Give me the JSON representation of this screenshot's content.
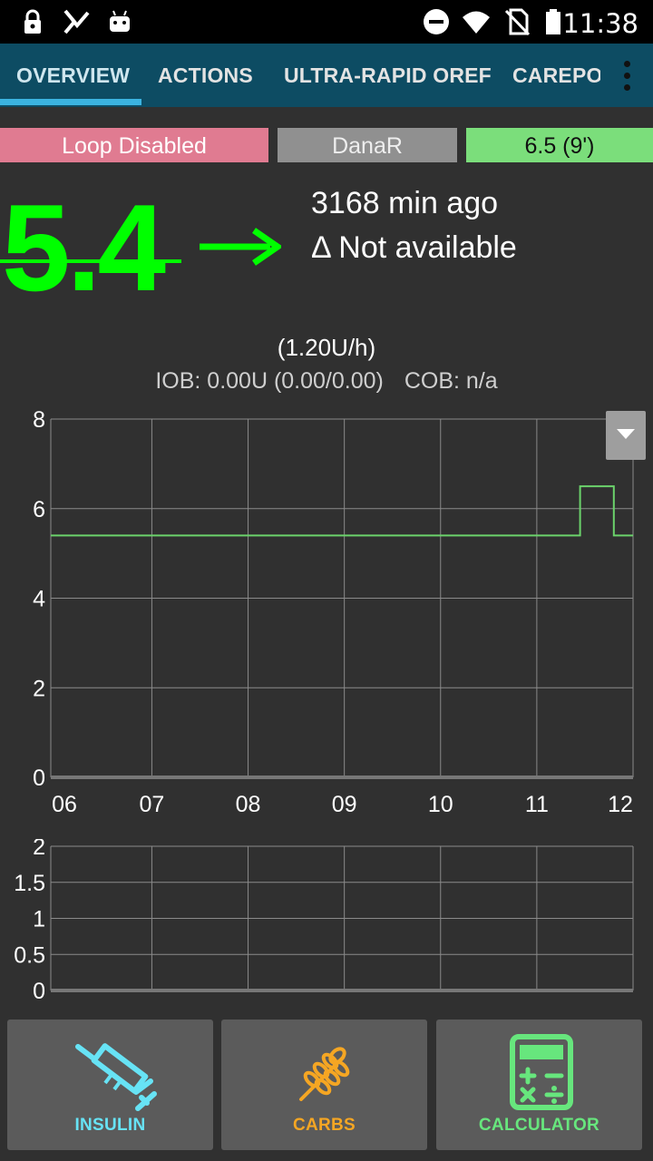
{
  "status_bar": {
    "time": "11:38"
  },
  "tabs": [
    {
      "label": "OVERVIEW",
      "active": true
    },
    {
      "label": "ACTIONS"
    },
    {
      "label": "ULTRA-RAPID OREF"
    },
    {
      "label": "CAREPORTAL"
    }
  ],
  "status": {
    "loop": "Loop Disabled",
    "pump": "DanaR",
    "profile": "6.5 (9')"
  },
  "bg": {
    "value": "5.4",
    "trend_icon": "arrow-right-icon",
    "minutes_ago": "3168 min ago",
    "delta": "Δ Not available"
  },
  "basal": "(1.20U/h)",
  "iob": {
    "label": "IOB:",
    "value": "0.00U (0.00/0.00)"
  },
  "cob": {
    "label": "COB:",
    "value": "n/a"
  },
  "colors": {
    "bg_green": "#00ff00",
    "loop_disabled": "#e07b91",
    "profile_green": "#7bde7b",
    "insulin": "#67e3f5",
    "carbs": "#f5a623",
    "calculator": "#67e67d"
  },
  "chart_data": [
    {
      "type": "line",
      "title": "",
      "ylim": [
        0,
        8
      ],
      "y_ticks": [
        "8",
        "6",
        "4",
        "2",
        "0"
      ],
      "x_ticks": [
        "06",
        "07",
        "08",
        "09",
        "10",
        "11",
        "12"
      ],
      "grid": true,
      "series": [
        {
          "color": "#6bd36b",
          "points": [
            {
              "x": 5.95,
              "y": 5.4
            },
            {
              "x": 11.45,
              "y": 5.4
            },
            {
              "x": 11.45,
              "y": 6.5
            },
            {
              "x": 11.8,
              "y": 6.5
            },
            {
              "x": 11.8,
              "y": 5.4
            },
            {
              "x": 12.0,
              "y": 5.4
            }
          ]
        }
      ]
    },
    {
      "type": "line",
      "title": "",
      "ylim": [
        0,
        2
      ],
      "y_ticks": [
        "2",
        "1.5",
        "1",
        "0.5",
        "0"
      ],
      "grid": true,
      "series": []
    }
  ],
  "buttons": [
    {
      "label": "INSULIN",
      "icon": "syringe-icon"
    },
    {
      "label": "CARBS",
      "icon": "wheat-icon"
    },
    {
      "label": "CALCULATOR",
      "icon": "calculator-icon"
    }
  ]
}
